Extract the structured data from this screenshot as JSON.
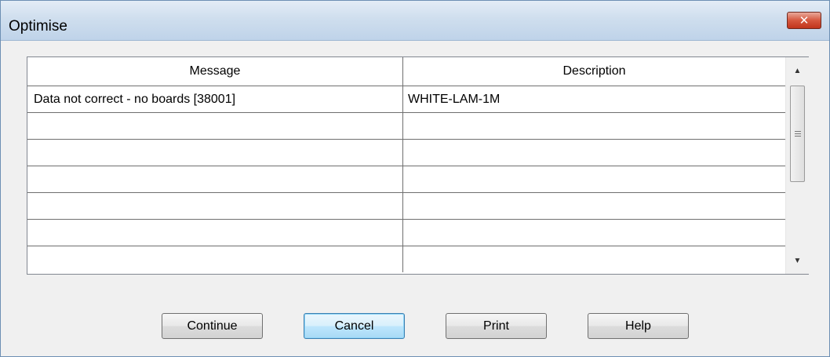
{
  "window": {
    "title": "Optimise",
    "close_glyph": "✕"
  },
  "grid": {
    "columns": [
      "Message",
      "Description"
    ],
    "rows": [
      {
        "message": "Data not correct - no boards [38001]",
        "description": "WHITE-LAM-1M"
      },
      {
        "message": "",
        "description": ""
      },
      {
        "message": "",
        "description": ""
      },
      {
        "message": "",
        "description": ""
      },
      {
        "message": "",
        "description": ""
      },
      {
        "message": "",
        "description": ""
      },
      {
        "message": "",
        "description": ""
      }
    ]
  },
  "scrollbar": {
    "up_glyph": "▲",
    "down_glyph": "▼"
  },
  "buttons": {
    "continue": "Continue",
    "cancel": "Cancel",
    "print": "Print",
    "help": "Help"
  }
}
